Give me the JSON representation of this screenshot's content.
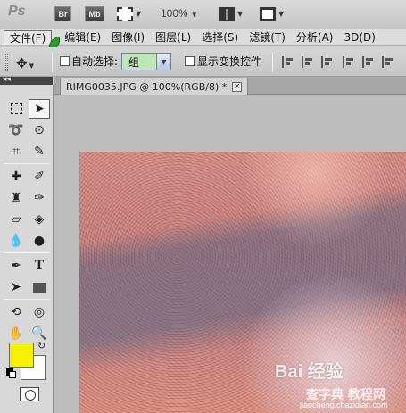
{
  "app": {
    "logo": "Ps",
    "bridge_label": "Br",
    "minibridge_label": "Mb",
    "zoom": "100%"
  },
  "menu": {
    "items": [
      "文件(F)",
      "编辑(E)",
      "图像(I)",
      "图层(L)",
      "选择(S)",
      "滤镜(T)",
      "分析(A)",
      "3D(D)"
    ]
  },
  "options": {
    "auto_select_label": "自动选择:",
    "auto_select_value": "组",
    "show_transform_label": "显示变换控件"
  },
  "document": {
    "tab_title": "RIMG0035.JPG @ 100%(RGB/8) *",
    "close_glyph": "×"
  },
  "colors": {
    "foreground": "#f6f200",
    "background": "#ffffff"
  },
  "watermark": {
    "logo_text": "Bai 经验",
    "sub_text": "查字典 教程网",
    "url": "jiaocheng.chazidian.com"
  },
  "icons": {
    "tools": [
      "rectangular-marquee-icon",
      "move-icon",
      "lasso-icon",
      "quick-selection-icon",
      "crop-icon",
      "eyedropper-icon",
      "spot-healing-icon",
      "brush-icon",
      "clone-stamp-icon",
      "history-brush-icon",
      "eraser-icon",
      "paint-bucket-icon",
      "blur-icon",
      "dodge-icon",
      "pen-icon",
      "type-icon",
      "path-selection-icon",
      "rectangle-shape-icon",
      "3d-rotate-icon",
      "3d-orbit-icon",
      "hand-icon",
      "zoom-icon"
    ]
  }
}
